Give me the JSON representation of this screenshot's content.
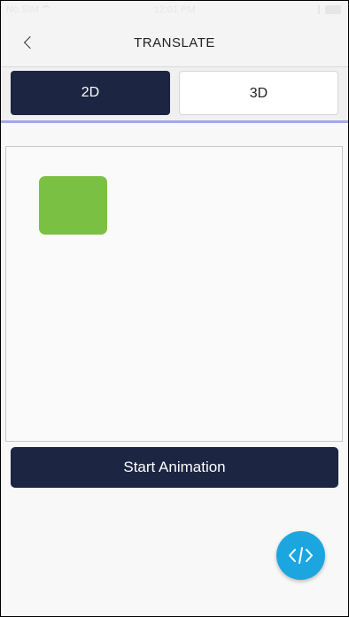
{
  "status_bar": {
    "carrier": "No SIM",
    "time": "12:01 PM"
  },
  "nav": {
    "title": "TRANSLATE",
    "back_icon": "chevron-left-icon"
  },
  "tabs": [
    {
      "label": "2D",
      "selected": true
    },
    {
      "label": "3D",
      "selected": false
    }
  ],
  "stage": {
    "shape_color": "#7ac143"
  },
  "start_button": {
    "label": "Start Animation"
  },
  "fab": {
    "icon": "code-icon",
    "color": "#1ba6e0"
  },
  "colors": {
    "primary": "#1c2541",
    "tab_underline": "#a4a7e8"
  }
}
